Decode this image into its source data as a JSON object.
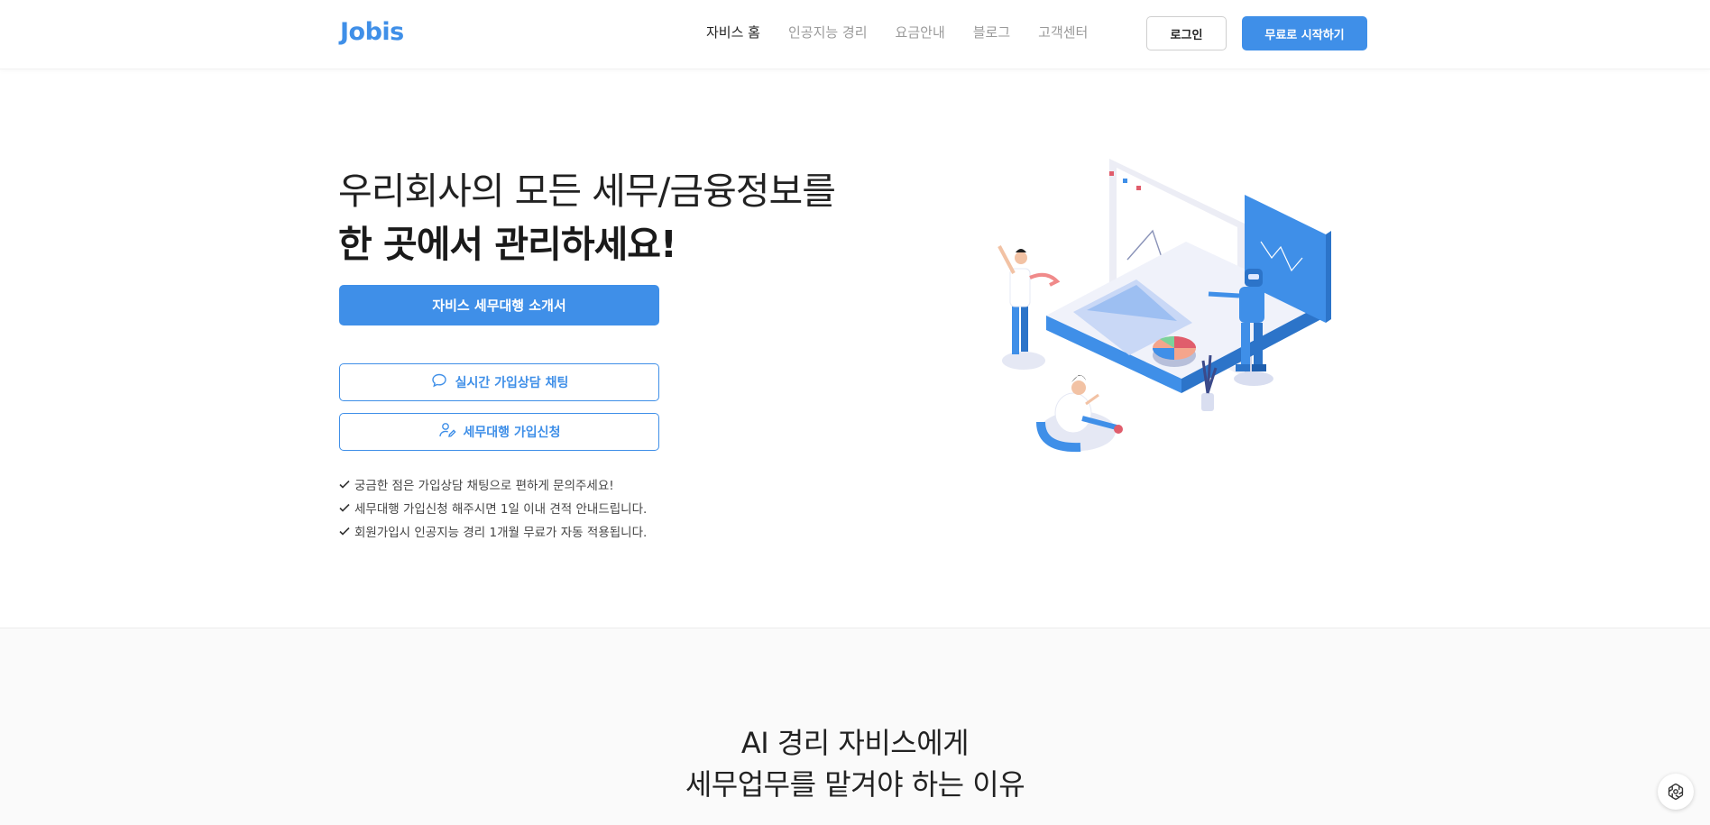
{
  "header": {
    "logo": "Jobis",
    "nav": [
      "자비스 홈",
      "인공지능 경리",
      "요금안내",
      "블로그",
      "고객센터"
    ],
    "login_label": "로그인",
    "start_label": "무료로 시작하기"
  },
  "hero": {
    "line1": "우리회사의 모든 세무/금융정보를",
    "line2": "한 곳에서 관리하세요!",
    "intro_button": "자비스 세무대행 소개서",
    "chat_button": "실시간 가입상담 채팅",
    "apply_button": "세무대행 가입신청",
    "notes": [
      "궁금한 점은 가입상담 채팅으로 편하게 문의주세요!",
      "세무대행 가입신청 해주시면 1일 이내 견적 안내드립니다.",
      "회원가입시 인공지능 경리 1개월 무료가 자동 적용됩니다."
    ]
  },
  "section2": {
    "line1": "AI 경리 자비스에게",
    "line2": "세무업무를 맡겨야 하는 이유"
  },
  "colors": {
    "accent": "#3f8fe8"
  },
  "icons": {
    "chat": "chat-bubble-icon",
    "apply": "user-edit-icon",
    "check": "check-icon",
    "assistant": "openai-icon"
  }
}
